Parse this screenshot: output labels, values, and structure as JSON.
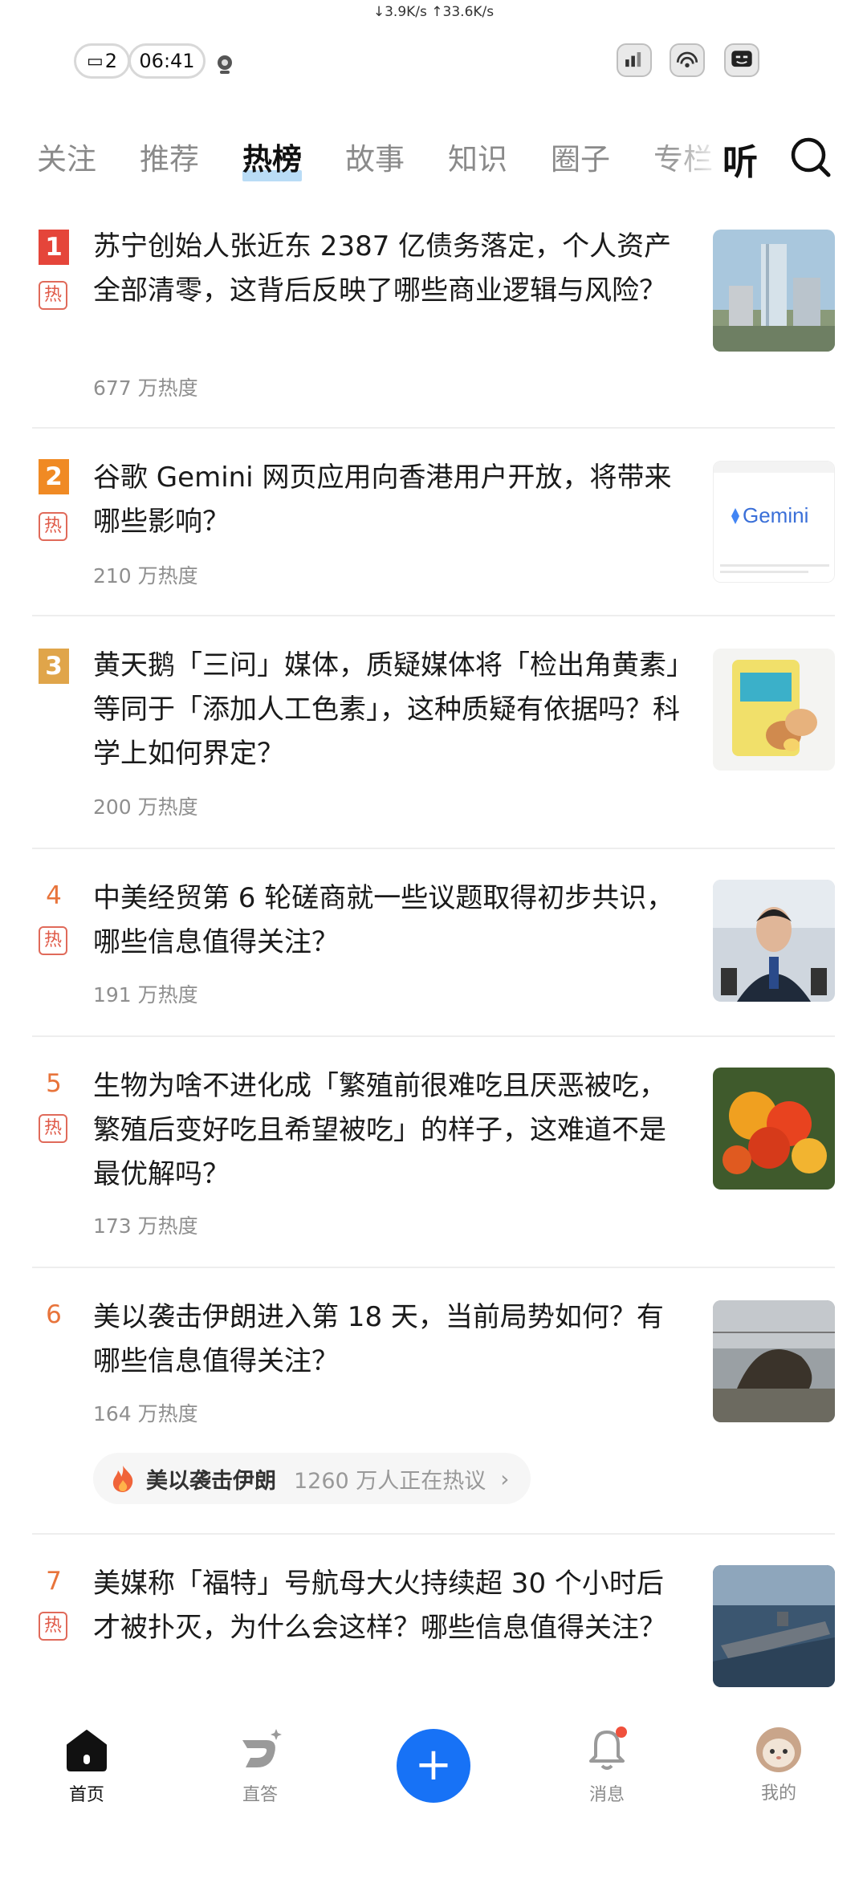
{
  "status_bar": {
    "net_speed": "↓3.9K/s ↑33.6K/s",
    "notif_count": "2",
    "time": "06:41"
  },
  "tabs": [
    "关注",
    "推荐",
    "热榜",
    "故事",
    "知识",
    "圈子",
    "专栏"
  ],
  "active_tab": "热榜",
  "listen_label": "听",
  "hot_label": "热",
  "items": [
    {
      "rank": "1",
      "title": "苏宁创始人张近东 2387 亿债务落定，个人资产全部清零，这背后反映了哪些商业逻辑与风险？",
      "heat": "677 万热度"
    },
    {
      "rank": "2",
      "title": "谷歌 Gemini 网页应用向香港用户开放，将带来哪些影响？",
      "heat": "210 万热度",
      "thumb_text": "Gemini"
    },
    {
      "rank": "3",
      "title": "黄天鹅「三问」媒体，质疑媒体将「检出角黄素」等同于「添加人工色素」，这种质疑有依据吗？科学上如何界定？",
      "heat": "200 万热度"
    },
    {
      "rank": "4",
      "title": "中美经贸第 6 轮磋商就一些议题取得初步共识，哪些信息值得关注？",
      "heat": "191 万热度"
    },
    {
      "rank": "5",
      "title": "生物为啥不进化成「繁殖前很难吃且厌恶被吃，繁殖后变好吃且希望被吃」的样子，这难道不是最优解吗？",
      "heat": "173 万热度"
    },
    {
      "rank": "6",
      "title": "美以袭击伊朗进入第 18 天，当前局势如何？有哪些信息值得关注？",
      "heat": "164 万热度"
    },
    {
      "rank": "7",
      "title": "美媒称「福特」号航母大火持续超 30 个小时后才被扑灭，为什么会这样？哪些信息值得关注？"
    }
  ],
  "topic": {
    "name": "美以袭击伊朗",
    "count": "1260 万人正在热议",
    "chevron": "›"
  },
  "bottom_nav": {
    "home": "首页",
    "zhida": "直答",
    "add": "+",
    "messages": "消息",
    "me": "我的"
  },
  "colors": {
    "accent": "#1772f6",
    "rank1": "#e5453a",
    "rank2": "#f08a24",
    "rank3": "#e0a54a",
    "rank_other": "#e8743b",
    "hot_tag": "#e05a48"
  }
}
